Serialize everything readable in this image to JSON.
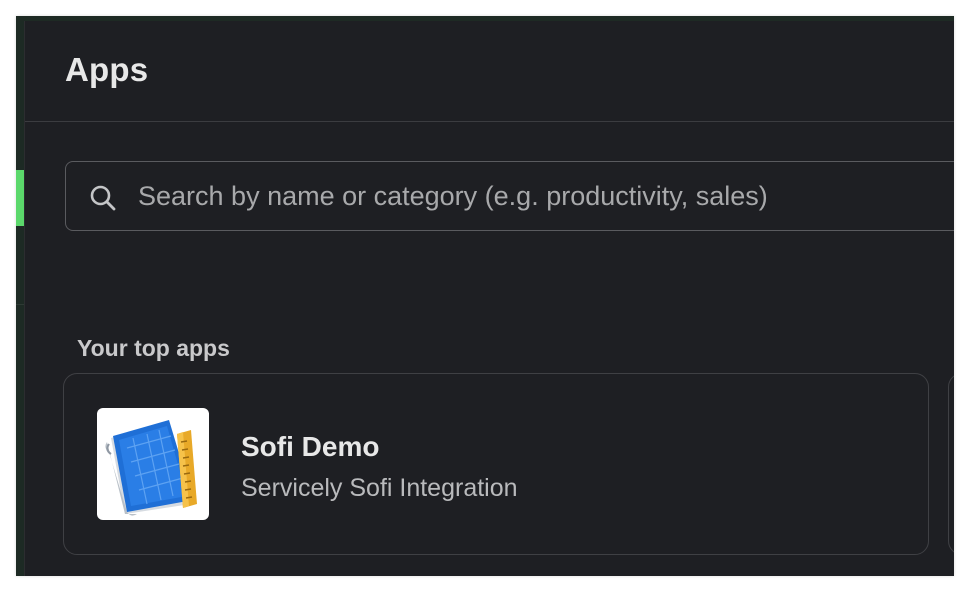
{
  "header": {
    "title": "Apps"
  },
  "search": {
    "placeholder": "Search by name or category (e.g. productivity, sales)",
    "icon": "search-icon"
  },
  "top_apps": {
    "section_title": "Your top apps",
    "items": [
      {
        "name": "Sofi Demo",
        "description": "Servicely Sofi Integration",
        "icon": "blueprint-ruler-icon"
      }
    ]
  },
  "colors": {
    "panel_background": "#1e1f23",
    "active_indicator": "#5bd86b",
    "text_primary": "#e8e8e8",
    "text_secondary": "#b9babc"
  }
}
